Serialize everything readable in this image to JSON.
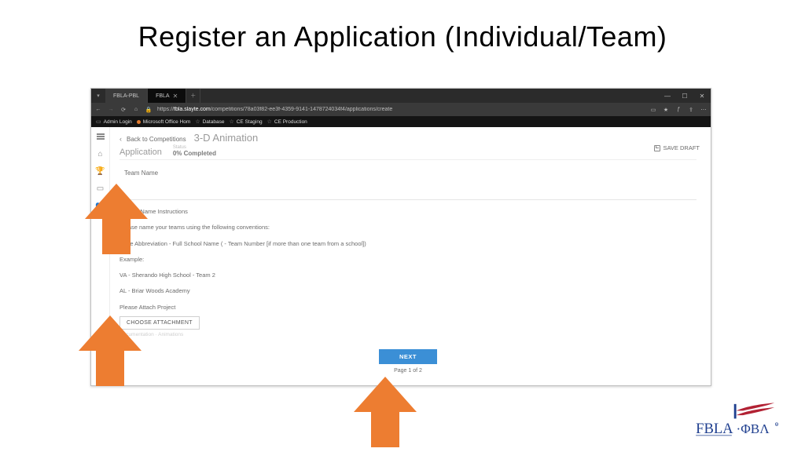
{
  "slide": {
    "title": "Register an Application (Individual/Team)"
  },
  "browser": {
    "tabs": {
      "inactive": "FBLA-PBL",
      "active": "FBLA"
    },
    "url_prefix": "https://",
    "url_domain": "fbla.slayte.com",
    "url_path": "/competitions/78a03f82-ee3f-4359-9141-1478724034f4/applications/create",
    "bookmarks": [
      "Admin Login",
      "Microsoft Office Hom",
      "Database",
      "CE Staging",
      "CE Production"
    ]
  },
  "page": {
    "back": "Back to Competitions",
    "title": "3-D Animation",
    "section": "Application",
    "status_label": "Status",
    "status_value": "0% Completed",
    "save_draft": "SAVE DRAFT",
    "team_name_label": "Team Name",
    "instr_header": "Team Name Instructions",
    "instr_line1": "Please name your teams using the following conventions:",
    "instr_line2": "State Abbreviation - Full School Name ( - Team Number [if more than one team from a school])",
    "instr_example_label": "Example:",
    "instr_example1": "VA - Sherando High School - Team 2",
    "instr_example2": "AL - Briar Woods Academy",
    "attach_label": "Please Attach Project",
    "choose_attachment": "CHOOSE ATTACHMENT",
    "attach_hint": "Documentation · Animations",
    "next": "NEXT",
    "page_of": "Page 1 of 2"
  },
  "logo": {
    "text": "FBLA·ΦBΛ"
  }
}
